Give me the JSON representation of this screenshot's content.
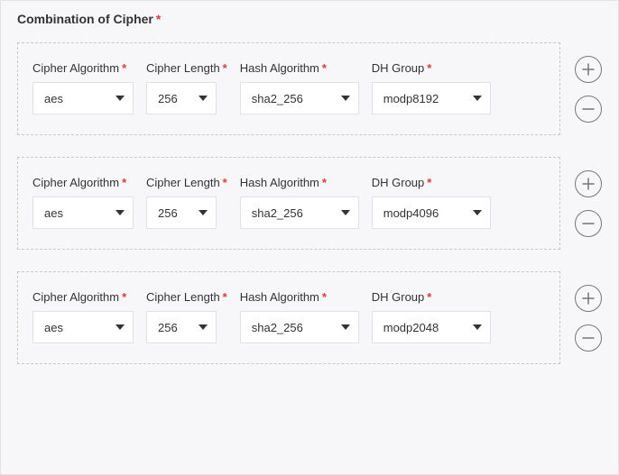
{
  "title": "Combination of Cipher",
  "labels": {
    "cipher_algorithm": "Cipher Algorithm",
    "cipher_length": "Cipher Length",
    "hash_algorithm": "Hash Algorithm",
    "dh_group": "DH Group"
  },
  "rows": [
    {
      "cipher_algorithm": "aes",
      "cipher_length": "256",
      "hash_algorithm": "sha2_256",
      "dh_group": "modp8192"
    },
    {
      "cipher_algorithm": "aes",
      "cipher_length": "256",
      "hash_algorithm": "sha2_256",
      "dh_group": "modp4096"
    },
    {
      "cipher_algorithm": "aes",
      "cipher_length": "256",
      "hash_algorithm": "sha2_256",
      "dh_group": "modp2048"
    }
  ]
}
